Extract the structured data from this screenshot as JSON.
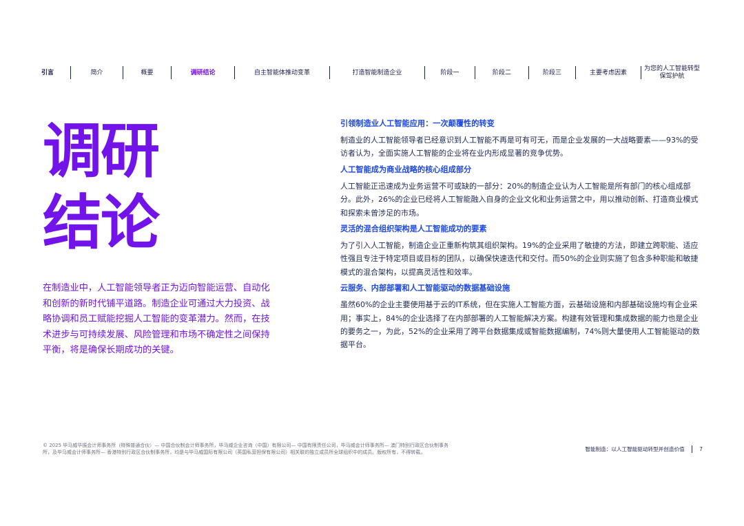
{
  "nav": {
    "items": [
      {
        "label": "引言"
      },
      {
        "label": "简介"
      },
      {
        "label": "概要"
      },
      {
        "label": "调研结论",
        "active": true
      },
      {
        "label": "自主智能体推动变革"
      },
      {
        "label": "打造智能制造企业"
      },
      {
        "label": "阶段一"
      },
      {
        "label": "阶段二"
      },
      {
        "label": "阶段三"
      },
      {
        "label": "主要考虑因素"
      },
      {
        "label": "为您的人工智能转型保驾护航"
      }
    ]
  },
  "title": {
    "line1": "调研",
    "line2": "结论"
  },
  "intro": "在制造业中，人工智能领导者正为迈向智能运营、自动化和创新的新时代铺平道路。制造企业可通过大力投资、战略协调和员工赋能挖掘人工智能的变革潜力。然而，在技术进步与可持续发展、风险管理和市场不确定性之间保持平衡，将是确保长期成功的关键。",
  "sections": [
    {
      "heading": "引领制造业人工智能应用：一次颠覆性的转变",
      "body": "制造业的人工智能领导者已经意识到人工智能不再是可有可无，而是企业发展的一大战略要素——93%的受访者认为，全面实施人工智能的企业将在业内形成显著的竞争优势。"
    },
    {
      "heading": "人工智能成为商业战略的核心组成部分",
      "body": "人工智能正迅速成为业务运营不可或缺的一部分：20%的制造企业认为人工智能是所有部门的核心组成部分。此外，26%的企业已经将人工智能融入自身的企业文化和业务运营之中，用以推动创新、打造商业模式和探索未曾涉足的市场。"
    },
    {
      "heading": "灵活的混合组织架构是人工智能成功的要素",
      "body": "为了引入人工智能，制造企业正重新构筑其组织架构。19%的企业采用了敏捷的方法，即建立跨职能、适应性强且专注于特定项目或目标的团队，以确保快速迭代和交付。而50%的企业则实施了包含多种职能和敏捷模式的混合架构，以提高灵活性和效率。"
    },
    {
      "heading": "云服务、内部部署和人工智能驱动的数据基础设施",
      "body": "虽然60%的企业主要使用基于云的IT系统，但在实施人工智能方面，云基础设施和内部基础设施均有企业采用；事实上，84%的企业选择了在内部部署的人工智能解决方案。构建有效管理和集成数据的能力也是企业的要务之一，为此，52%的企业采用了跨平台数据集成或智能数据编制，74%则大量使用人工智能驱动的数据平台。"
    }
  ],
  "footer": {
    "legal": "© 2025 毕马威华振会计师事务所（特殊普通合伙）— 中国合伙制会计师事务所，毕马威企业咨询（中国）有限公司— 中国有限责任公司，毕马威会计师事务所— 澳门特别行政区合伙制事务所，及毕马威会计师事务所— 香港特别行政区合伙制事务所，均是与毕马威国际有限公司（英国私营担保有限公司）相关联的独立成员所全球组织中的成员。版权所有，不得转载。",
    "doc_title": "智能制造：以人工智能驱动转型并创造价值",
    "page_number": "7"
  },
  "colors": {
    "accent_purple": "#7213ea",
    "heading_blue": "#1e49e2",
    "body_navy": "#1e2a55"
  }
}
